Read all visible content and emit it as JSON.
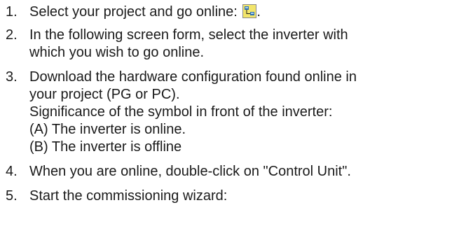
{
  "steps": [
    {
      "num": "1.",
      "lines": [
        "Select your project and go online: "
      ],
      "trailing": "."
    },
    {
      "num": "2.",
      "lines": [
        "In the following screen form, select the inverter with",
        "which you wish to go online."
      ]
    },
    {
      "num": "3.",
      "lines": [
        "Download the hardware configuration found online in",
        "your project (PG or PC).",
        "Significance of the symbol in front of the inverter:",
        "(A) The inverter is online.",
        "(B) The inverter is offline"
      ]
    },
    {
      "num": "4.",
      "lines": [
        "When you are online, double-click on \"Control Unit\"."
      ]
    },
    {
      "num": "5.",
      "lines": [
        "Start the commissioning wizard:"
      ]
    }
  ],
  "icons": {
    "go_online": "go-online-icon"
  },
  "colors": {
    "text": "#1a1a1a",
    "icon_bg": "#f2e56b",
    "icon_node": "#2c6fb0"
  }
}
